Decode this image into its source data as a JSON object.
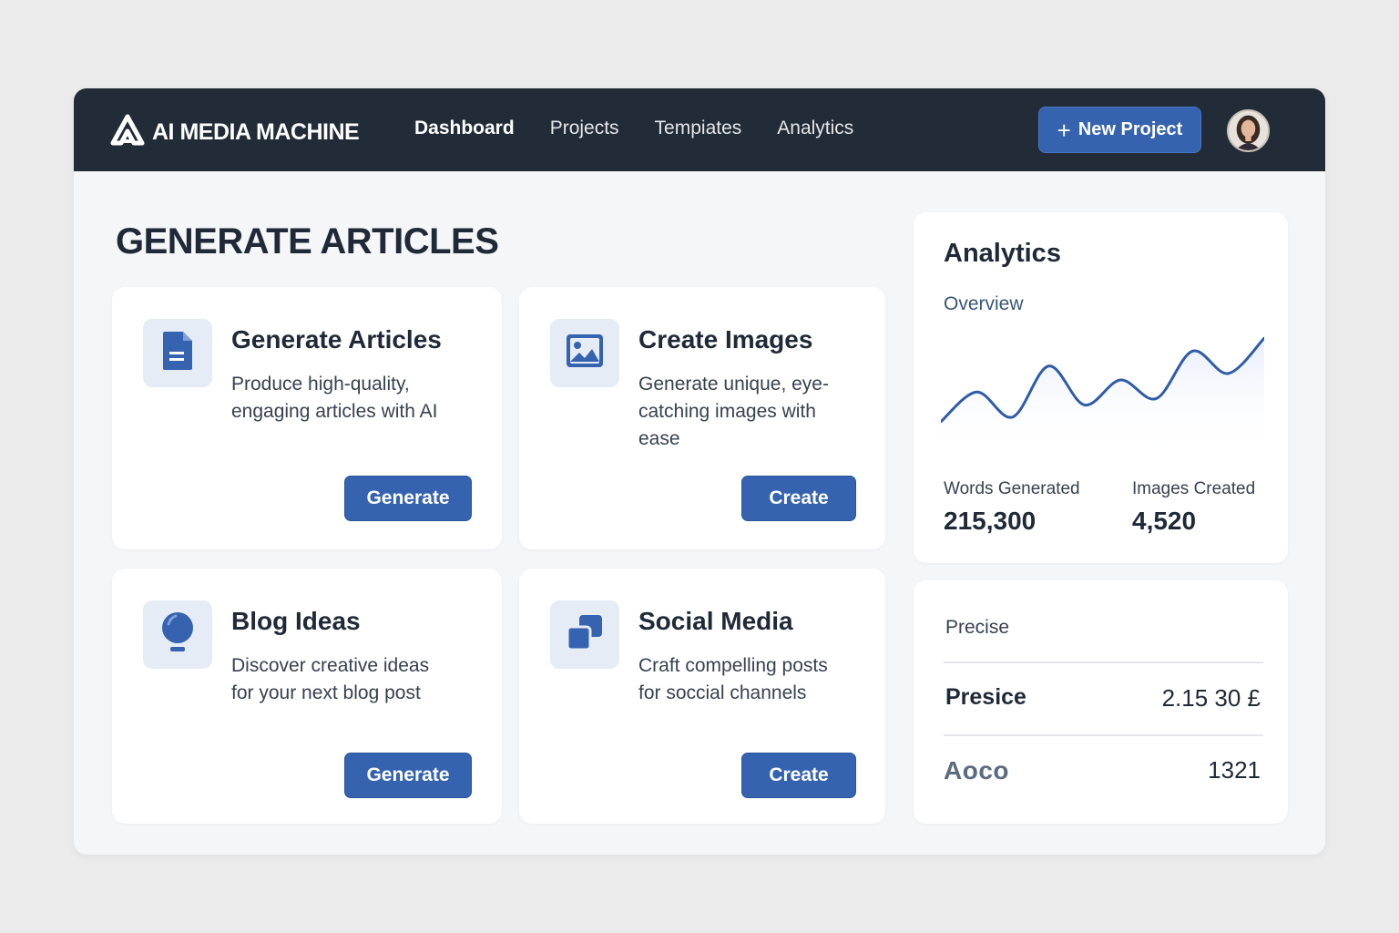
{
  "app": {
    "name": "AI MEDIA MACHINE",
    "logo_icon": "triangle-a-logo-icon"
  },
  "nav": {
    "items": [
      {
        "label": "Dashboard",
        "active": true
      },
      {
        "label": "Projects",
        "active": false
      },
      {
        "label": "Tempiates",
        "active": false
      },
      {
        "label": "Analytics",
        "active": false
      }
    ]
  },
  "header": {
    "new_project_label": "New Project",
    "new_project_icon": "plus-icon",
    "avatar_icon": "user-avatar"
  },
  "page": {
    "title": "GENERATE ARTICLES"
  },
  "cards": [
    {
      "title": "Generate Articles",
      "description": "Produce high-quality, engaging articles with AI",
      "button": "Generate",
      "icon": "document-icon"
    },
    {
      "title": "Create Images",
      "description": "Generate unique, eye-catching images with ease",
      "button": "Create",
      "icon": "image-icon"
    },
    {
      "title": "Blog Ideas",
      "description": "Discover creative ideas for your next blog post",
      "button": "Generate",
      "icon": "lightbulb-icon"
    },
    {
      "title": "Social Media",
      "description": "Craft compelling posts for soccial channels",
      "button": "Create",
      "icon": "chat-bubbles-icon"
    }
  ],
  "analytics": {
    "title": "Analytics",
    "subtitle": "Overview",
    "stats": [
      {
        "label": "Words Generated",
        "value": "215,300"
      },
      {
        "label": "Images Created",
        "value": "4,520"
      }
    ]
  },
  "chart_data": {
    "type": "line",
    "title": "",
    "xlabel": "",
    "ylabel": "",
    "grid": false,
    "series": [
      {
        "values": [
          10,
          42,
          15,
          70,
          28,
          55,
          35,
          86,
          62,
          100
        ]
      }
    ],
    "ylim": [
      0,
      110
    ],
    "colors": {
      "line": "#2f5ba8",
      "fill_top": "#e9eefb"
    }
  },
  "precise_panel": {
    "heading": "Precise",
    "rows": [
      {
        "label": "Presice",
        "value": "2.15 30 £"
      },
      {
        "label": "Aoco",
        "value": "1321"
      }
    ]
  },
  "colors": {
    "topbar": "#222b38",
    "accent": "#3563b0",
    "page_bg": "#f5f6f8"
  }
}
